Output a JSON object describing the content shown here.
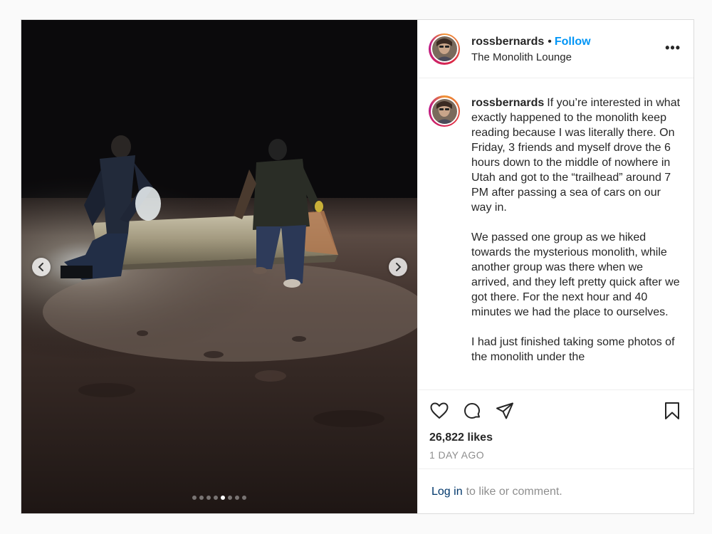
{
  "post": {
    "username": "rossbernards",
    "follow_label": "Follow",
    "bullet": "•",
    "location": "The Monolith Lounge",
    "more_label": "•••",
    "caption_paragraphs": [
      "If you’re interested in what exactly happened to the monolith keep reading because I was literally there. On Friday, 3 friends and myself drove the 6 hours down to the middle of nowhere in Utah and got to the “trailhead” around 7 PM after passing a sea of cars on our way in.",
      "We passed one group as we hiked towards the mysterious monolith, while another group was there when we arrived, and they left pretty quick after we got there. For the next hour and 40 minutes we had the place to ourselves.",
      "I had just finished taking some photos of the monolith under the"
    ],
    "likes": "26,822 likes",
    "time_ago": "1 DAY AGO",
    "login_link": "Log in",
    "login_suffix": "to like or comment."
  },
  "carousel": {
    "total": 8,
    "active_index": 4
  },
  "icons": {
    "like": "heart-icon",
    "comment": "comment-icon",
    "share": "paper-plane-icon",
    "save": "bookmark-icon",
    "prev": "chevron-left-icon",
    "next": "chevron-right-icon"
  },
  "colors": {
    "accent": "#0095f6",
    "link": "#00376b",
    "muted": "#8e8e8e",
    "border": "#dbdbdb"
  }
}
